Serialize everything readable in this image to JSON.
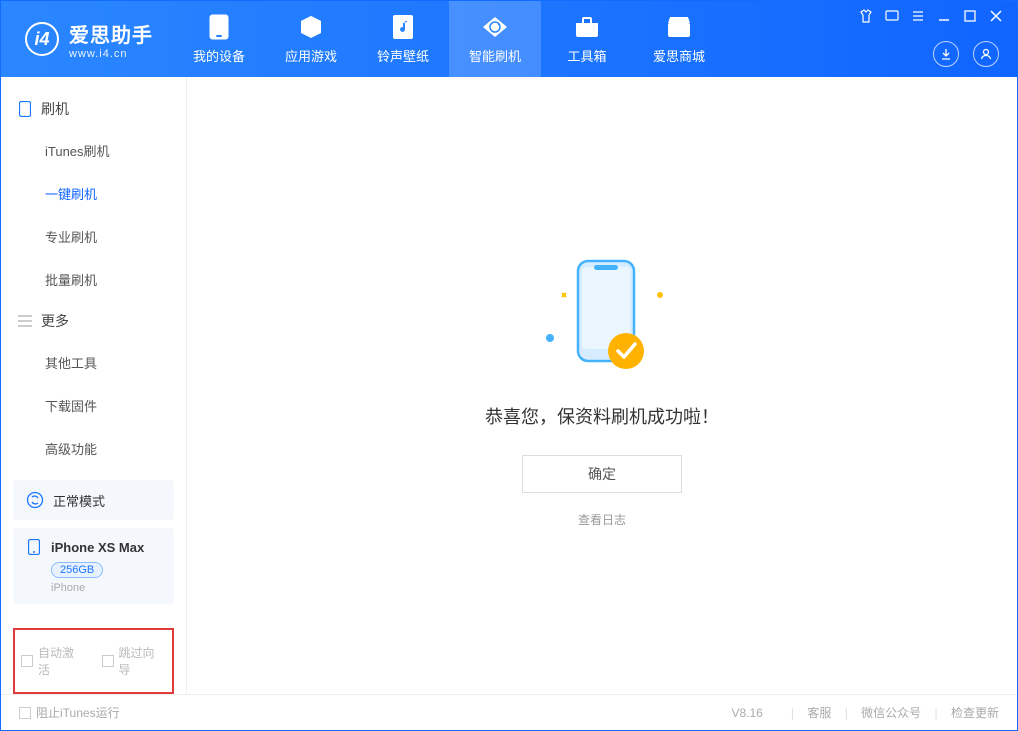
{
  "logo": {
    "cn": "爱思助手",
    "en": "www.i4.cn"
  },
  "nav": {
    "items": [
      {
        "label": "我的设备"
      },
      {
        "label": "应用游戏"
      },
      {
        "label": "铃声壁纸"
      },
      {
        "label": "智能刷机"
      },
      {
        "label": "工具箱"
      },
      {
        "label": "爱思商城"
      }
    ]
  },
  "sidebar": {
    "sections": [
      {
        "title": "刷机",
        "items": [
          "iTunes刷机",
          "一键刷机",
          "专业刷机",
          "批量刷机"
        ]
      },
      {
        "title": "更多",
        "items": [
          "其他工具",
          "下载固件",
          "高级功能"
        ]
      }
    ],
    "mode": "正常模式",
    "device": {
      "name": "iPhone XS Max",
      "storage": "256GB",
      "type": "iPhone"
    },
    "checkboxes": {
      "autoActivate": "自动激活",
      "skipGuide": "跳过向导"
    }
  },
  "main": {
    "successTitle": "恭喜您，保资料刷机成功啦！",
    "okButton": "确定",
    "viewLog": "查看日志"
  },
  "footer": {
    "blockItunes": "阻止iTunes运行",
    "version": "V8.16",
    "links": [
      "客服",
      "微信公众号",
      "检查更新"
    ]
  }
}
